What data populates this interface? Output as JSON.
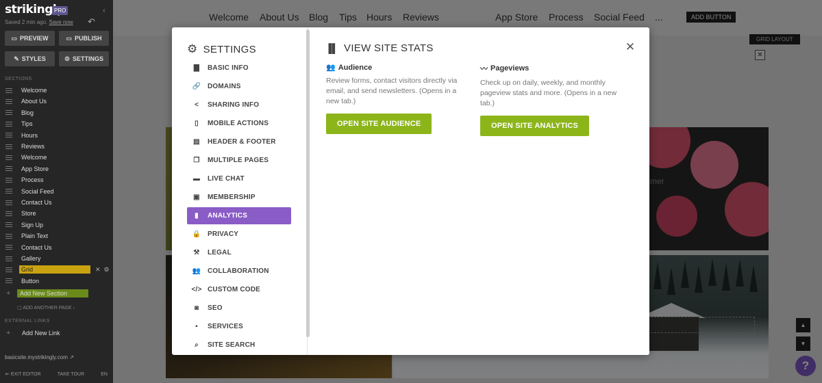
{
  "sidebar": {
    "logo": "strikingly",
    "pro_badge": "PRO",
    "saved_text": "Saved 2 min ago.",
    "save_now": "Save now",
    "preview_label": "PREVIEW",
    "publish_label": "PUBLISH",
    "styles_label": "STYLES",
    "settings_label": "SETTINGS",
    "sections_header": "SECTIONS",
    "sections": [
      {
        "label": "Welcome"
      },
      {
        "label": "About Us"
      },
      {
        "label": "Blog"
      },
      {
        "label": "Tips"
      },
      {
        "label": "Hours"
      },
      {
        "label": "Reviews"
      },
      {
        "label": "Welcome"
      },
      {
        "label": "App Store"
      },
      {
        "label": "Process"
      },
      {
        "label": "Social Feed"
      },
      {
        "label": "Contact Us"
      },
      {
        "label": "Store"
      },
      {
        "label": "Sign Up"
      },
      {
        "label": "Plain Text"
      },
      {
        "label": "Contact Us"
      },
      {
        "label": "Gallery"
      },
      {
        "label": "Grid"
      },
      {
        "label": "Button"
      }
    ],
    "active_section": "Grid",
    "add_section_label": "Add New Section",
    "add_page_label": "ADD ANOTHER PAGE ›",
    "external_links_header": "EXTERNAL LINKS",
    "add_link_label": "Add New Link",
    "site_url": "basicsite.mystrikingly.com",
    "exit_editor": "EXIT EDITOR",
    "take_tour": "TAKE TOUR",
    "language": "EN"
  },
  "site": {
    "nav": [
      "Welcome",
      "About Us",
      "Blog",
      "Tips",
      "Hours",
      "Reviews",
      "App Store",
      "Process",
      "Social Feed",
      "..."
    ],
    "nav_button": "ADD BUTTON",
    "grid_layout_label": "GRID LAYOUT",
    "partial_text": "mmer"
  },
  "modal": {
    "title": "SETTINGS",
    "menu": [
      {
        "label": "BASIC INFO",
        "icon": "briefcase-icon",
        "glyph": "▇"
      },
      {
        "label": "DOMAINS",
        "icon": "link-icon",
        "glyph": "🔗"
      },
      {
        "label": "SHARING INFO",
        "icon": "share-icon",
        "glyph": "<"
      },
      {
        "label": "MOBILE ACTIONS",
        "icon": "mobile-icon",
        "glyph": "▯"
      },
      {
        "label": "HEADER & FOOTER",
        "icon": "header-footer-icon",
        "glyph": "▤"
      },
      {
        "label": "MULTIPLE PAGES",
        "icon": "pages-icon",
        "glyph": "❐"
      },
      {
        "label": "LIVE CHAT",
        "icon": "chat-icon",
        "glyph": "▬"
      },
      {
        "label": "MEMBERSHIP",
        "icon": "membership-icon",
        "glyph": "▣"
      },
      {
        "label": "ANALYTICS",
        "icon": "analytics-icon",
        "glyph": "▮"
      },
      {
        "label": "PRIVACY",
        "icon": "lock-icon",
        "glyph": "🔒"
      },
      {
        "label": "LEGAL",
        "icon": "gavel-icon",
        "glyph": "⚒"
      },
      {
        "label": "COLLABORATION",
        "icon": "users-icon",
        "glyph": "👥"
      },
      {
        "label": "CUSTOM CODE",
        "icon": "code-icon",
        "glyph": "</>"
      },
      {
        "label": "SEO",
        "icon": "seo-icon",
        "glyph": "◙"
      },
      {
        "label": "SERVICES",
        "icon": "services-icon",
        "glyph": "▪"
      },
      {
        "label": "SITE SEARCH",
        "icon": "search-icon",
        "glyph": "⌕"
      }
    ],
    "active_item": "ANALYTICS",
    "content": {
      "title": "VIEW SITE STATS",
      "audience": {
        "heading": "Audience",
        "description": "Review forms, contact visitors directly via email, and send newsletters. (Opens in a new tab.)",
        "button": "OPEN SITE AUDIENCE"
      },
      "pageviews": {
        "heading": "Pageviews",
        "description": "Check up on daily, weekly, and monthly pageview stats and more. (Opens in a new tab.)",
        "button": "OPEN SITE ANALYTICS"
      }
    }
  },
  "colors": {
    "accent_purple": "#8a5cc6",
    "button_green": "#8cb51a",
    "active_section_yellow": "#c9a20f",
    "sidebar_bg": "#262626"
  }
}
